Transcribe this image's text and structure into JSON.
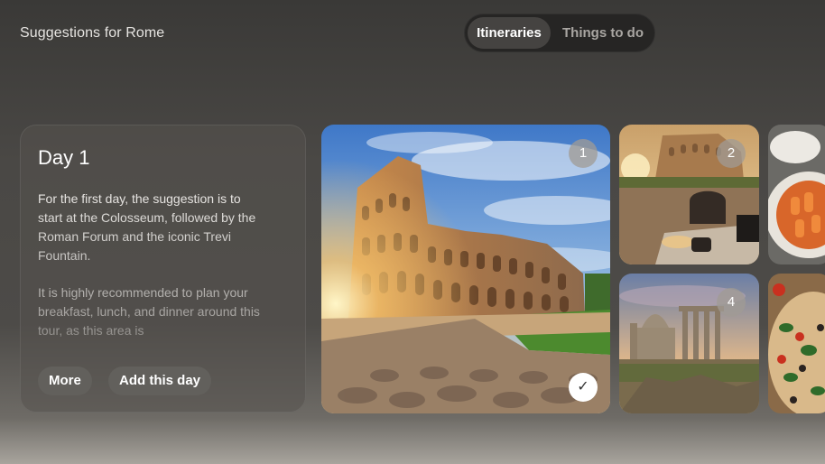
{
  "header": {
    "title": "Suggestions for Rome"
  },
  "tabs": [
    {
      "label": "Itineraries",
      "selected": true
    },
    {
      "label": "Things to do",
      "selected": false
    }
  ],
  "day_card": {
    "heading": "Day 1",
    "paragraphs": [
      "For the first day, the suggestion is to start at the Colosseum, followed by the Roman Forum and the iconic Trevi Fountain.",
      "It is highly recommended to plan your breakfast, lunch, and dinner around this tour, as this area is"
    ],
    "more_label": "More",
    "add_label": "Add this day"
  },
  "gallery": {
    "tiles": [
      {
        "subject": "Colosseum at sunrise",
        "badge": "1",
        "selected": true
      },
      {
        "subject": "Cafe table near the Colosseum",
        "badge": "2"
      },
      {
        "subject": "Pasta dish",
        "badge": ""
      },
      {
        "subject": "Roman Forum ruins",
        "badge": "4"
      },
      {
        "subject": "Pizza",
        "badge": ""
      }
    ],
    "check_icon": "checkmark-icon"
  },
  "colors": {
    "background": "#4a4845",
    "card": "#55524e",
    "button": "#62605c",
    "segment_bg": "#262524",
    "segment_active": "#454341"
  }
}
